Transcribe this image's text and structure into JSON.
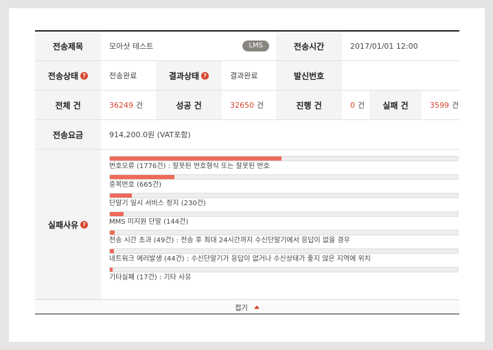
{
  "info": {
    "title_label": "전송제목",
    "title_value": "모아샷 테스트",
    "type_badge": "LMS",
    "time_label": "전송시간",
    "time_value": "2017/01/01 12:00",
    "status_label": "전송상태",
    "status_value": "전송완료",
    "result_label": "결과상태",
    "result_value": "결과완료",
    "sender_label": "발신번호",
    "sender_value": ""
  },
  "counts": {
    "total_label": "전체 건",
    "total_value": "36249",
    "success_label": "성공 건",
    "success_value": "32650",
    "progress_label": "진행 건",
    "progress_value": "0",
    "fail_label": "실패 건",
    "fail_value": "3599",
    "unit": "건"
  },
  "fee": {
    "label": "전송요금",
    "value": "914,200.0원 (VAT포함)"
  },
  "failure": {
    "label": "실패사유",
    "items": [
      {
        "label": "번호오류 (1776건) : 잘못된 번호형식 또는 잘못된 번호",
        "ratio": 0.4935
      },
      {
        "label": "중복번호 (665건)",
        "ratio": 0.1848
      },
      {
        "label": "단말기 일시 서비스 정지 (230건)",
        "ratio": 0.0639
      },
      {
        "label": "MMS 미지원 단말 (144건)",
        "ratio": 0.04
      },
      {
        "label": "전송 시간 초과 (49건) : 전송 후 최대 24시간까지 수신단말기에서 응답이 없을 경우",
        "ratio": 0.0136
      },
      {
        "label": "네트워크 에러발생 (44건) : 수신단말기가 응답이 없거나 수신상태가 좋지 않은 지역에 위치",
        "ratio": 0.0122
      },
      {
        "label": "기타실패 (17건) : 기타 사유",
        "ratio": 0.0047
      }
    ]
  },
  "footer": {
    "collapse_label": "접기"
  },
  "colors": {
    "accent": "#d6442d",
    "bar_fill": "#ee6b5a",
    "badge": "#888580"
  }
}
